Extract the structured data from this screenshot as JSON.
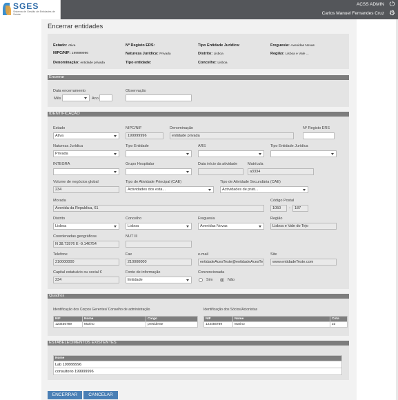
{
  "header": {
    "logo_name": "SGES",
    "logo_subtitle": "Sistema de Gestão de Entidades de Saúde",
    "user_role": "ACSS ADMIN",
    "user_name": "Carlos Manuel Fernandes Cruz",
    "power_icon": "power-icon",
    "settings_icon": "gear-icon"
  },
  "page": {
    "title": "Encerrar entidades"
  },
  "summary": {
    "estado_label": "Estado:",
    "estado_value": "Ativa",
    "nipc_label": "NIPC/NIF:",
    "nipc_value": "199999996",
    "denominacao_label": "Denominação:",
    "denominacao_value": "entidade privada",
    "registo_label": "Nº Registo ERS:",
    "registo_value": "",
    "natureza_label": "Natureza Jurídica:",
    "natureza_value": "Privada",
    "tipo_label": "Tipo entidade:",
    "tipo_value": "",
    "tipo_juridica_label": "Tipo Entidade Jurídica:",
    "tipo_juridica_value": "",
    "distrito_label": "Distrito:",
    "distrito_value": "Lisboa",
    "concelho_label": "Concelho:",
    "concelho_value": "Lisboa",
    "freguesia_label": "Freguesia:",
    "freguesia_value": "Avenidas Novas",
    "regiao_label": "Região:",
    "regiao_value": "Lisboa e Vale ..."
  },
  "encerrar": {
    "section": "Encerrar",
    "data_label": "Data encerramento",
    "mes_label": "Mês",
    "ano_label": "Ano",
    "mes_value": "",
    "ano_value": "",
    "obs_label": "Observação",
    "obs_value": ""
  },
  "ident": {
    "section": "IDENTIFICAÇÃO",
    "estado_label": "Estado",
    "estado_value": "Ativa",
    "nipc_label": "NIPC/NIF",
    "nipc_value": "199999996",
    "denominacao_label": "Denominação",
    "denominacao_value": "entidade privada",
    "registo_label": "Nº Registo ERS",
    "registo_value": "",
    "natureza_label": "Natureza Jurídica",
    "natureza_value": "Privada",
    "tipo_label": "Tipo Entidade",
    "tipo_value": "",
    "ars_label": "ARS",
    "ars_value": "",
    "tipo_juridica_label": "Tipo Entidade Jurídica",
    "tipo_juridica_value": "",
    "integra_label": "INTEGRA",
    "integra_value": "",
    "grupo_label": "Grupo Hospitalar",
    "grupo_value": "",
    "inicio_label": "Data início da atividade",
    "inicio_value": "",
    "matricula_label": "Matrícula",
    "matricula_value": "a3334",
    "volume_label": "Volume de negócios global",
    "volume_value": "234",
    "cae_principal_label": "Tipo de Atividade Principal (CAE)",
    "cae_principal_value": "Actividades dos esta...",
    "cae_secundaria_label": "Tipo de Atividade Secundária (CAE)",
    "cae_secundaria_value": "Actividades de práti...",
    "morada_label": "Morada",
    "morada_value": "Avenida da Republica, 61",
    "codigo_label": "Código Postal",
    "codigo_value1": "1050",
    "codigo_sep": "-",
    "codigo_value2": "187",
    "distrito_label": "Distrito",
    "distrito_value": "Lisboa",
    "concelho_label": "Concelho",
    "concelho_value": "Lisboa",
    "freguesia_label": "Freguesia",
    "freguesia_value": "Avenidas Novas",
    "regiao_label": "Região",
    "regiao_value": "Lisboa e Vale do Tejo",
    "coords_label": "Coordenadas geográficas",
    "coords_value": "N 38.73976 E -9.146754",
    "nut_label": "NUT III",
    "nut_value": "",
    "telefone_label": "Telefone",
    "telefone_value": "210000000",
    "fax_label": "Fax",
    "fax_value": "210000000",
    "email_label": "e-mail",
    "email_value": "entidadeAcesTeste@entidadeAcesTe",
    "site_label": "Site",
    "site_value": "www.entidadeTeste.com",
    "capital_label": "Capital estatuário ou social €",
    "capital_value": "234",
    "fonte_label": "Fonte de informação",
    "fonte_value": "Entidade",
    "convencionada_label": "Convencionada",
    "sim_label": "Sim",
    "nao_label": "Não"
  },
  "quadros": {
    "section": "Quadros",
    "gerentes_title": "Identificação dos Corpos Gerentes/ Conselho de administração",
    "gerentes_headers": [
      "NIF",
      "Nome",
      "Cargo"
    ],
    "gerentes_rows": [
      [
        "123456789",
        "Marino",
        "presidente"
      ]
    ],
    "socios_title": "Identificação dos Sócios/Acionistas",
    "socios_headers": [
      "NIF",
      "Nome",
      "Cota"
    ],
    "socios_rows": [
      [
        "123456789",
        "Marino",
        "23"
      ]
    ]
  },
  "estabelecimentos": {
    "section": "ESTABELECIMENTOS EXISTENTES",
    "header": "Nome",
    "rows": [
      "Lab 199999996",
      "consultorio 199999996"
    ]
  },
  "actions": {
    "encerrar": "ENCERRAR",
    "cancelar": "CANCELAR"
  }
}
